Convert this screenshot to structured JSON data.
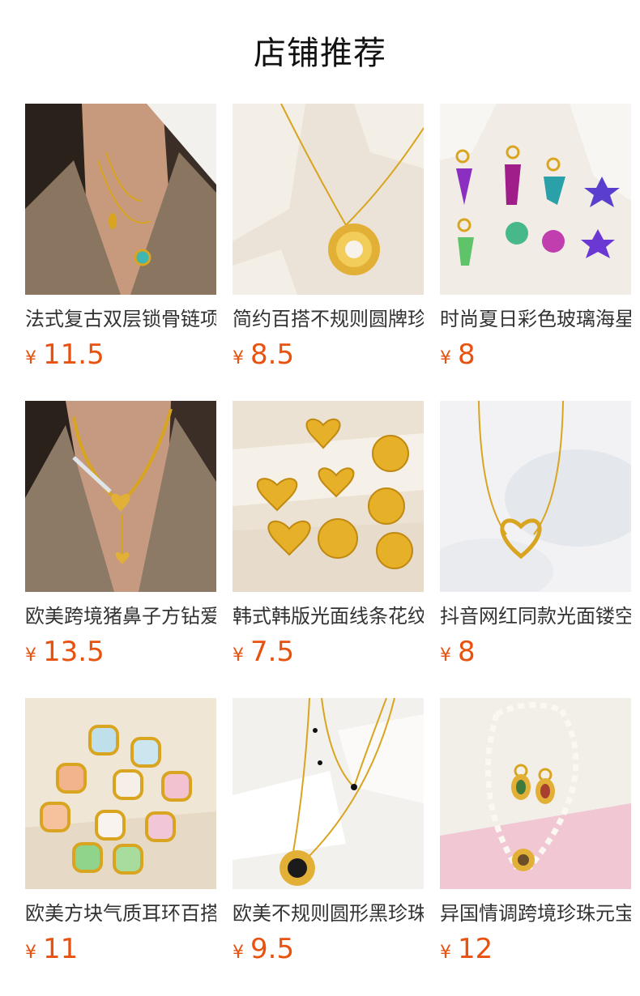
{
  "header": {
    "title": "店铺推荐"
  },
  "products": [
    {
      "name": "法式复古双层锁骨链项链",
      "currency": "¥",
      "price": "11.5"
    },
    {
      "name": "简约百搭不规则圆牌珍珠项链",
      "currency": "¥",
      "price": "8.5"
    },
    {
      "name": "时尚夏日彩色玻璃海星耳环",
      "currency": "¥",
      "price": "8"
    },
    {
      "name": "欧美跨境猪鼻子方钻爱心项链",
      "currency": "¥",
      "price": "13.5"
    },
    {
      "name": "韩式韩版光面线条花纹爱心耳钉",
      "currency": "¥",
      "price": "7.5"
    },
    {
      "name": "抖音网红同款光面镂空爱心项链",
      "currency": "¥",
      "price": "8"
    },
    {
      "name": "欧美方块气质耳环百搭耳钉",
      "currency": "¥",
      "price": "11"
    },
    {
      "name": "欧美不规则圆形黑珍珠双层项链",
      "currency": "¥",
      "price": "9.5"
    },
    {
      "name": "异国情调跨境珍珠元宝套装",
      "currency": "¥",
      "price": "12"
    }
  ],
  "colors": {
    "price": "#e8520f",
    "title": "#111111",
    "name": "#333333",
    "gold": "#d9a520"
  },
  "images": [
    "necklace-on-model-beige-blazer",
    "pearl-pendant-necklace-on-stone",
    "colorful-crystal-earrings",
    "heart-pendant-necklace-on-model",
    "gold-heart-stud-earrings",
    "open-heart-pendant-necklace",
    "square-gemstone-stud-earrings",
    "black-pearl-layered-necklace",
    "pearl-necklace-earring-set"
  ]
}
